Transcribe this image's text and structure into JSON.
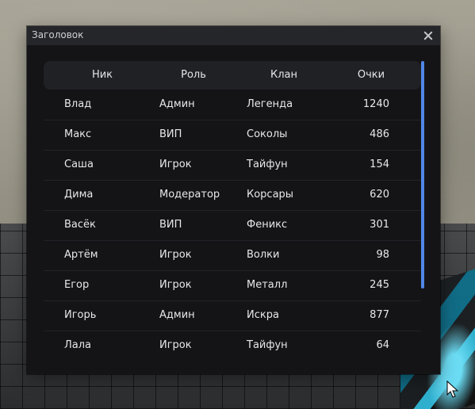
{
  "window": {
    "title": "Заголовок"
  },
  "table": {
    "columns": [
      "Ник",
      "Роль",
      "Клан",
      "Очки"
    ],
    "rows": [
      {
        "nick": "Влад",
        "role": "Админ",
        "clan": "Легенда",
        "score": "1240"
      },
      {
        "nick": "Макс",
        "role": "ВИП",
        "clan": "Соколы",
        "score": "486"
      },
      {
        "nick": "Саша",
        "role": "Игрок",
        "clan": "Тайфун",
        "score": "154"
      },
      {
        "nick": "Дима",
        "role": "Модератор",
        "clan": "Корсары",
        "score": "620"
      },
      {
        "nick": "Васёк",
        "role": "ВИП",
        "clan": "Феникс",
        "score": "301"
      },
      {
        "nick": "Артём",
        "role": "Игрок",
        "clan": "Волки",
        "score": "98"
      },
      {
        "nick": "Егор",
        "role": "Игрок",
        "clan": "Металл",
        "score": "245"
      },
      {
        "nick": "Игорь",
        "role": "Админ",
        "clan": "Искра",
        "score": "877"
      },
      {
        "nick": "Лала",
        "role": "Игрок",
        "clan": "Тайфун",
        "score": "64"
      }
    ]
  },
  "colors": {
    "window_bg": "#141417",
    "titlebar_bg": "#25262a",
    "header_bg": "#202125",
    "accent_scrollbar": "#4f87e8"
  },
  "icons": {
    "close": "close-icon",
    "cursor": "mouse-cursor-icon"
  }
}
